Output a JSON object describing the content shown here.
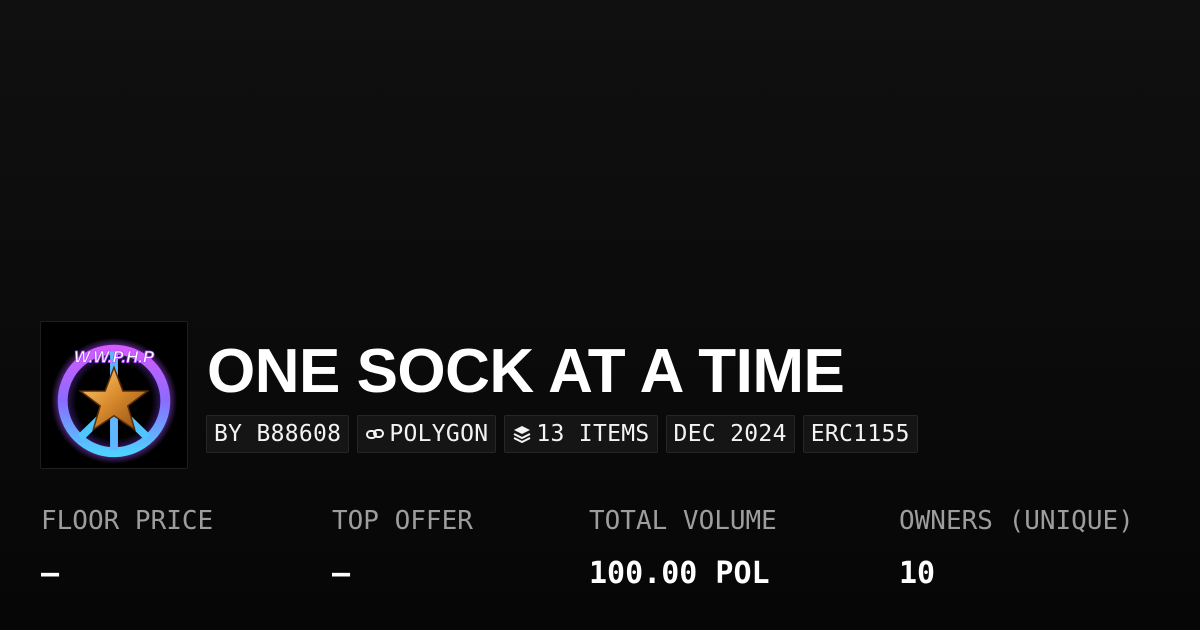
{
  "collection": {
    "title": "ONE SOCK AT A TIME",
    "logo_text": "W.W.P.H.P"
  },
  "chips": {
    "creator": "BY B88608",
    "chain_icon": "link-icon",
    "chain": "POLYGON",
    "items_icon": "layers-icon",
    "items": "13 ITEMS",
    "date": "DEC 2024",
    "standard": "ERC1155"
  },
  "stats": {
    "floor_price": {
      "label": "FLOOR PRICE",
      "value": "–"
    },
    "top_offer": {
      "label": "TOP OFFER",
      "value": "–"
    },
    "total_volume": {
      "label": "TOTAL VOLUME",
      "value": "100.00 POL"
    },
    "owners": {
      "label": "OWNERS (UNIQUE)",
      "value": "10"
    }
  },
  "colors": {
    "background": "#0b0b0b",
    "chip_background": "#151515",
    "label": "#9d9d9d",
    "text": "#ffffff"
  }
}
